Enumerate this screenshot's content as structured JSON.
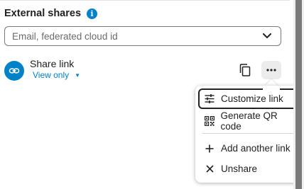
{
  "section": {
    "title": "External shares",
    "info_icon": "info-icon"
  },
  "share_input": {
    "placeholder": "Email, federated cloud id",
    "chevron_icon": "chevron-down-icon"
  },
  "share_link": {
    "title": "Share link",
    "permission": "View only",
    "permission_caret": "▼",
    "avatar_icon": "link-icon",
    "copy_icon": "copy-icon",
    "more_icon": "more-horizontal-icon"
  },
  "menu": {
    "items": [
      {
        "label": "Customize link",
        "icon": "tune-icon",
        "focused": true
      },
      {
        "label": "Generate QR code",
        "icon": "qr-code-icon",
        "focused": false
      },
      {
        "label": "Add another link",
        "icon": "plus-icon",
        "focused": false
      },
      {
        "label": "Unshare",
        "icon": "close-icon",
        "focused": false
      }
    ]
  },
  "colors": {
    "accent": "#0082c9",
    "text": "#222222",
    "muted_text": "#6b6b6b",
    "scrollbar_thumb": "#7a7a7a"
  }
}
